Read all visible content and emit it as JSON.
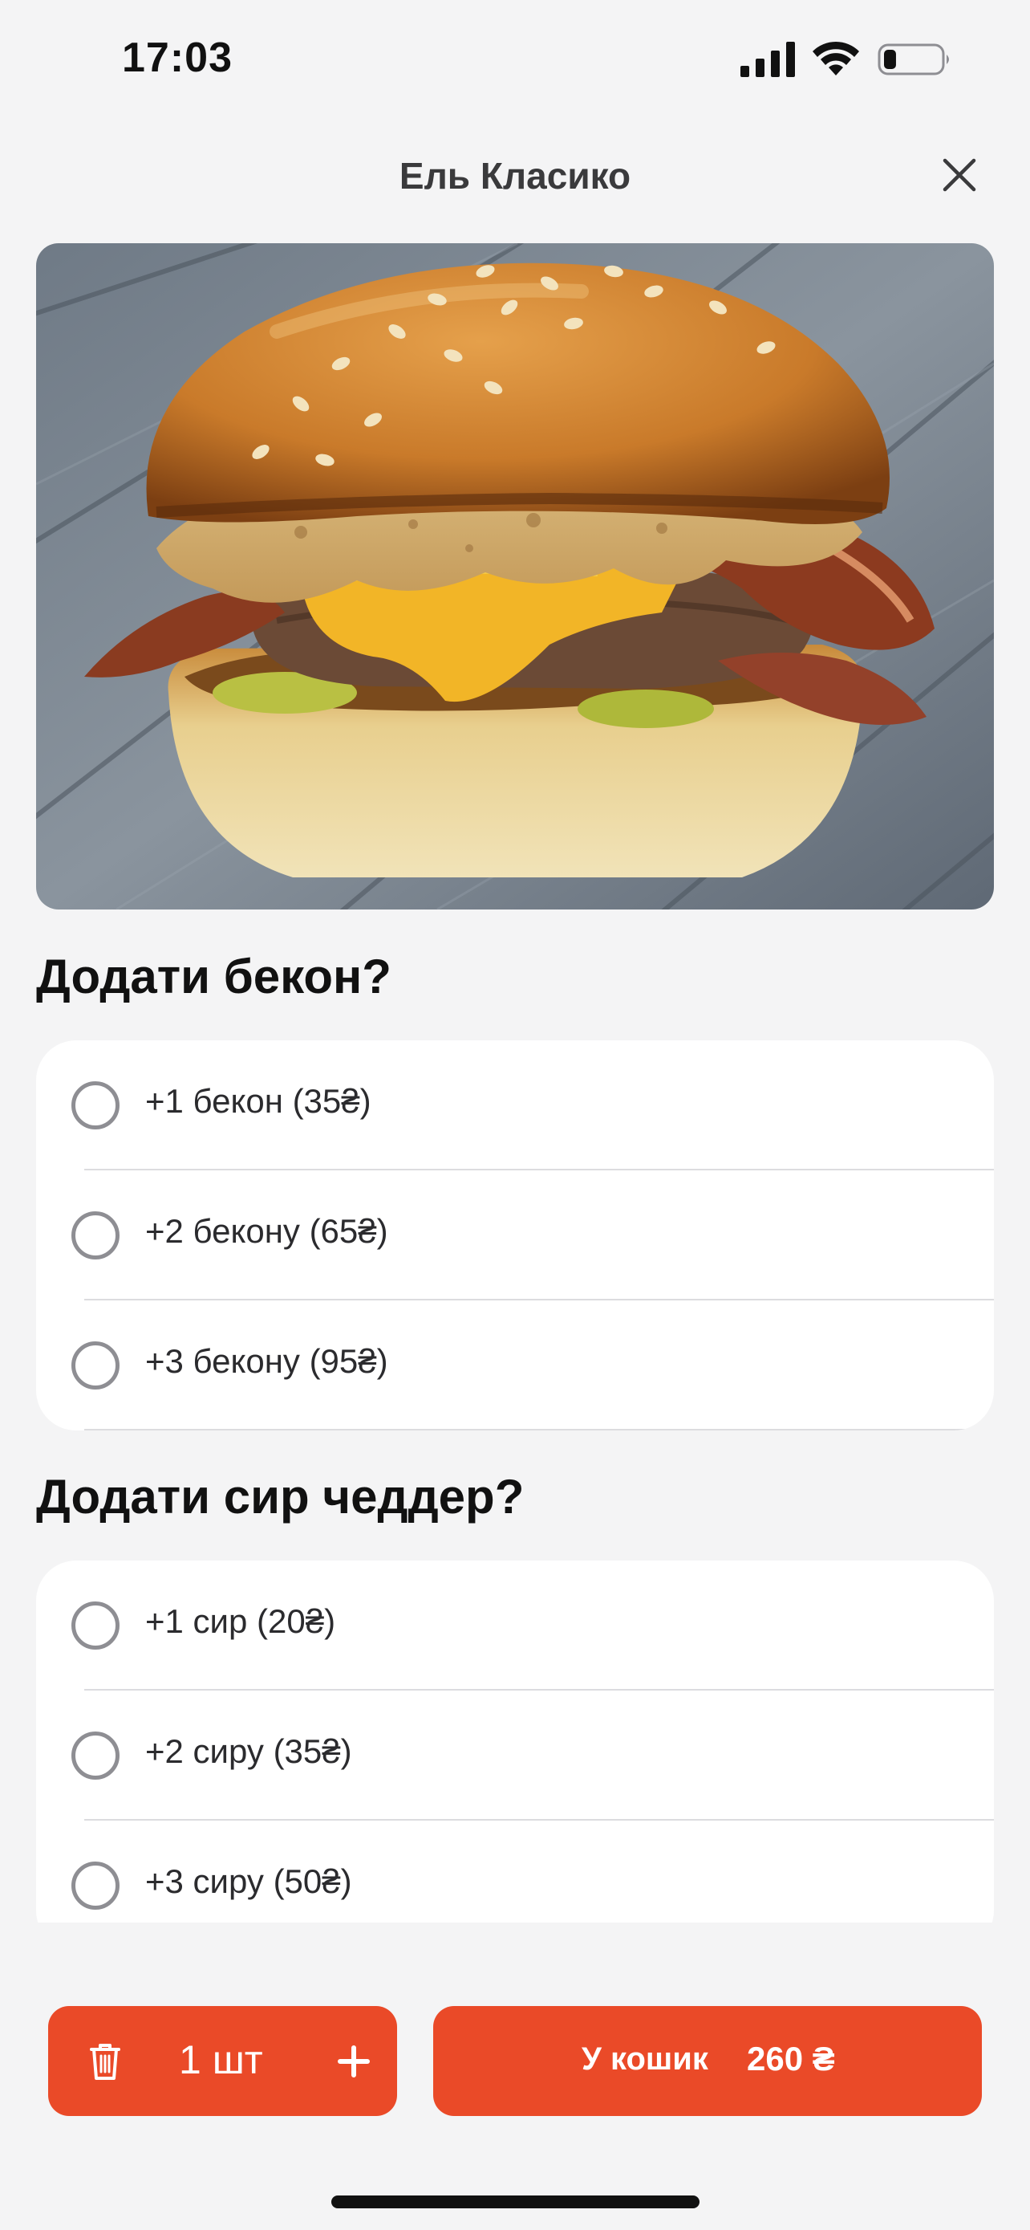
{
  "status_bar": {
    "time": "17:03",
    "battery_level": 0.22
  },
  "header": {
    "title": "Ель Класико"
  },
  "product": {
    "image_icon": "burger-photo"
  },
  "sections": [
    {
      "title": "Додати бекон?",
      "options": [
        {
          "label": "+1 бекон (35₴)",
          "selected": false
        },
        {
          "label": "+2 бекону (65₴)",
          "selected": false
        },
        {
          "label": "+3 бекону (95₴)",
          "selected": false
        }
      ]
    },
    {
      "title": "Додати сир чеддер?",
      "options": [
        {
          "label": "+1 сир (20₴)",
          "selected": false
        },
        {
          "label": "+2 сиру (35₴)",
          "selected": false
        },
        {
          "label": "+3 сиру (50₴)",
          "selected": false
        }
      ]
    }
  ],
  "bottom_bar": {
    "quantity_label": "1 шт",
    "cart_label": "У кошик",
    "cart_price": "260 ₴",
    "accent_color": "#ea4a28"
  }
}
